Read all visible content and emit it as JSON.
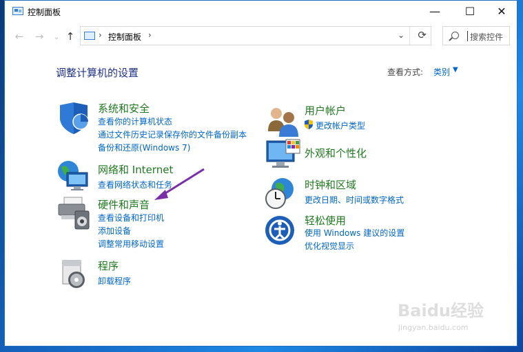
{
  "window": {
    "title": "控制面板"
  },
  "window_controls": {
    "minimize": "—",
    "maximize": "☐",
    "close": "✕"
  },
  "nav": {
    "back": "←",
    "forward": "→",
    "dropdown": "⌄",
    "up": "↑"
  },
  "address": {
    "crumb": "控制面板",
    "sep1": "›",
    "sep2": "›",
    "dropdown": "⌄",
    "refresh": "⟳"
  },
  "search": {
    "placeholder": "搜索控件"
  },
  "header": {
    "title": "调整计算机的设置",
    "viewby_label": "查看方式:",
    "viewby_value": "类别",
    "viewby_caret": "▼"
  },
  "categories": [
    {
      "title": "系统和安全",
      "icon": "shield-icon",
      "links": [
        "查看你的计算机状态",
        "通过文件历史记录保存你的文件备份副本",
        "备份和还原(Windows 7)"
      ]
    },
    {
      "title": "网络和 Internet",
      "icon": "network-globe-icon",
      "links": [
        "查看网络状态和任务"
      ]
    },
    {
      "title": "硬件和声音",
      "icon": "printer-speaker-icon",
      "links": [
        "查看设备和打印机",
        "添加设备",
        "调整常用移动设置"
      ]
    },
    {
      "title": "程序",
      "icon": "programs-disc-icon",
      "links": [
        "卸载程序"
      ]
    },
    {
      "title": "用户帐户",
      "icon": "users-icon",
      "links": [
        "更改帐户类型"
      ]
    },
    {
      "title": "外观和个性化",
      "icon": "monitor-palette-icon",
      "links": []
    },
    {
      "title": "时钟和区域",
      "icon": "clock-globe-icon",
      "links": [
        "更改日期、时间或数字格式"
      ]
    },
    {
      "title": "轻松使用",
      "icon": "ease-of-access-icon",
      "links": [
        "使用 Windows 建议的设置",
        "优化视觉显示"
      ]
    }
  ],
  "watermark": {
    "brand": "Baidu经验",
    "url": "jingyan.baidu.com"
  },
  "colors": {
    "link": "#0066cc",
    "category": "#1f7a1f",
    "title": "#1e3287",
    "arrow": "#7b2fa6"
  }
}
